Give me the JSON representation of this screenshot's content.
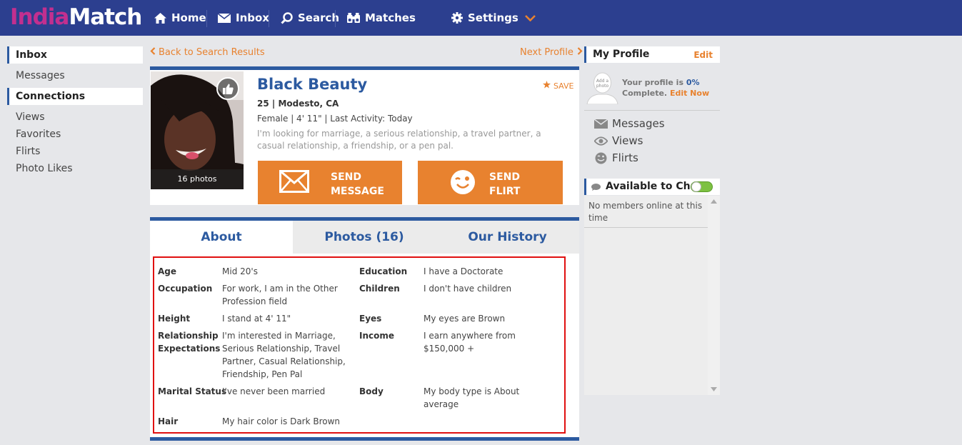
{
  "header": {
    "logo_part1": "India",
    "logo_part2": "Match",
    "nav": {
      "home": "Home",
      "inbox": "Inbox",
      "search": "Search",
      "matches": "Matches",
      "settings": "Settings"
    }
  },
  "sidebar": {
    "inbox_header": "Inbox",
    "messages": "Messages",
    "connections_header": "Connections",
    "views": "Views",
    "favorites": "Favorites",
    "flirts": "Flirts",
    "photo_likes": "Photo Likes"
  },
  "nav_links": {
    "back": "Back to Search Results",
    "next": "Next Profile"
  },
  "profile": {
    "name": "Black Beauty",
    "age_location": "25 | Modesto, CA",
    "info": "Female | 4' 11\" | Last Activity: Today",
    "bio": "I'm looking for marriage, a serious relationship, a travel partner, a casual relationship, a friendship, or a pen pal.",
    "photo_count": "16 photos",
    "save": "SAVE",
    "send_message_line1": "SEND",
    "send_message_line2": "MESSAGE",
    "send_flirt_line1": "SEND",
    "send_flirt_line2": "FLIRT"
  },
  "tabs": {
    "about": "About",
    "photos": "Photos (16)",
    "history": "Our History"
  },
  "details": [
    {
      "label": "Age",
      "value": "Mid 20's"
    },
    {
      "label": "Education",
      "value": "I have a Doctorate"
    },
    {
      "label": "Occupation",
      "value": "For work, I am in the Other Profession field"
    },
    {
      "label": "Children",
      "value": "I don't have children"
    },
    {
      "label": "Height",
      "value": "I stand at 4' 11\""
    },
    {
      "label": "Eyes",
      "value": "My eyes are Brown"
    },
    {
      "label": "Relationship Expectations",
      "value": "I'm interested in Marriage, Serious Relationship, Travel Partner, Casual Relationship, Friendship, Pen Pal"
    },
    {
      "label": "Income",
      "value": "I earn anywhere from $150,000 +"
    },
    {
      "label": "Marital Status",
      "value": "I've never been married"
    },
    {
      "label": "Body",
      "value": "My body type is About average"
    },
    {
      "label": "Hair",
      "value": "My hair color is Dark Brown"
    }
  ],
  "right": {
    "my_profile": "My Profile",
    "edit": "Edit",
    "avatar_text": "Add a photo",
    "status_prefix": "Your profile is ",
    "percent": "0%",
    "status_suffix": "Complete. ",
    "edit_now": "Edit Now",
    "messages": "Messages",
    "views": "Views",
    "flirts": "Flirts",
    "chat_title": "Available to Chat",
    "chat_empty": "No members online at this time"
  },
  "colors": {
    "brand_blue": "#2c3f8f",
    "accent_orange": "#e8822f",
    "logo_pink": "#c22f8f",
    "highlight_red": "#e01010"
  }
}
